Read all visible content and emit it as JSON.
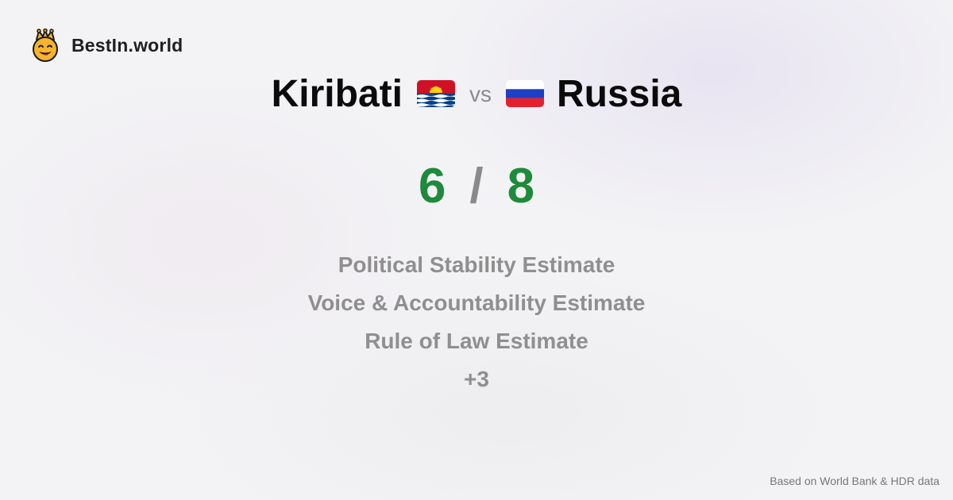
{
  "brand": {
    "name": "BestIn.world",
    "icon": "crowned-smiley-icon"
  },
  "comparison": {
    "left_country": "Kiribati",
    "left_flag": "kiribati-flag-icon",
    "vs": "vs",
    "right_country": "Russia",
    "right_flag": "russia-flag-icon"
  },
  "score": {
    "left": "6",
    "separator": "/",
    "right": "8"
  },
  "metrics": [
    "Political Stability Estimate",
    "Voice & Accountability Estimate",
    "Rule of Law Estimate",
    "+3"
  ],
  "footer": "Based on World Bank & HDR data",
  "colors": {
    "score_green": "#1e8a3c",
    "muted_gray": "#8f8f8f",
    "title_black": "#0b0b0b"
  }
}
